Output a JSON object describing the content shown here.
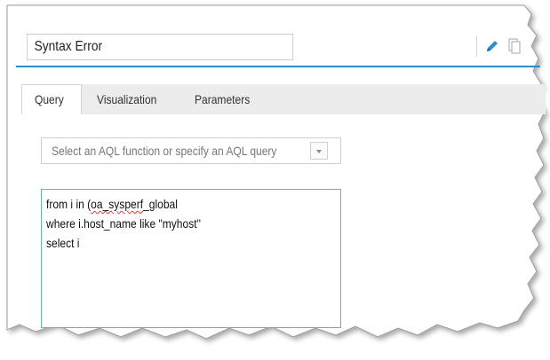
{
  "query_editor": {
    "title_value": "Syntax Error",
    "tabs": [
      {
        "label": "Query",
        "active": true
      },
      {
        "label": "Visualization",
        "active": false
      },
      {
        "label": "Parameters",
        "active": false
      }
    ],
    "aql_select_placeholder": "Select an AQL function or specify an AQL query",
    "query_lines": {
      "line1_prefix": "from i in (",
      "line1_misspelled": "oa_sysperf",
      "line1_suffix": "_global",
      "line2": "where i.host_name like \"myhost\"",
      "line3": "select i"
    }
  },
  "toolbar": {
    "icons": [
      "edit-icon",
      "copy-icon"
    ]
  },
  "colors": {
    "accent": "#2a8fc9",
    "focus_border": "#5aaee0",
    "tabbar_bg": "#ececec",
    "spellcheck": "#e0362c"
  }
}
